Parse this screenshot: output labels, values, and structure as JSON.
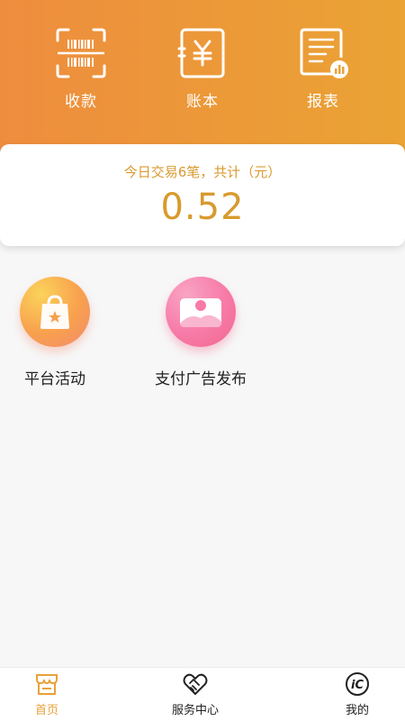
{
  "header": {
    "actions": [
      {
        "label": "收款",
        "icon": "barcode-scan-icon"
      },
      {
        "label": "账本",
        "icon": "yen-ledger-icon"
      },
      {
        "label": "报表",
        "icon": "report-icon"
      }
    ]
  },
  "summary": {
    "title": "今日交易6笔，共计（元）",
    "amount": "0.52"
  },
  "features": [
    {
      "label": "平台活动",
      "icon": "shopping-bag-icon"
    },
    {
      "label": "支付广告发布",
      "icon": "landscape-image-icon"
    }
  ],
  "tabbar": {
    "items": [
      {
        "label": "首页",
        "icon": "store-icon",
        "active": true
      },
      {
        "label": "服务中心",
        "icon": "handshake-icon",
        "active": false
      },
      {
        "label": "我的",
        "icon": "ic-logo-icon",
        "active": false
      }
    ]
  },
  "colors": {
    "header_gradient_start": "#ee8d3e",
    "header_gradient_end": "#eaa334",
    "amount": "#d89a2e",
    "active_tab": "#e8a23a"
  }
}
